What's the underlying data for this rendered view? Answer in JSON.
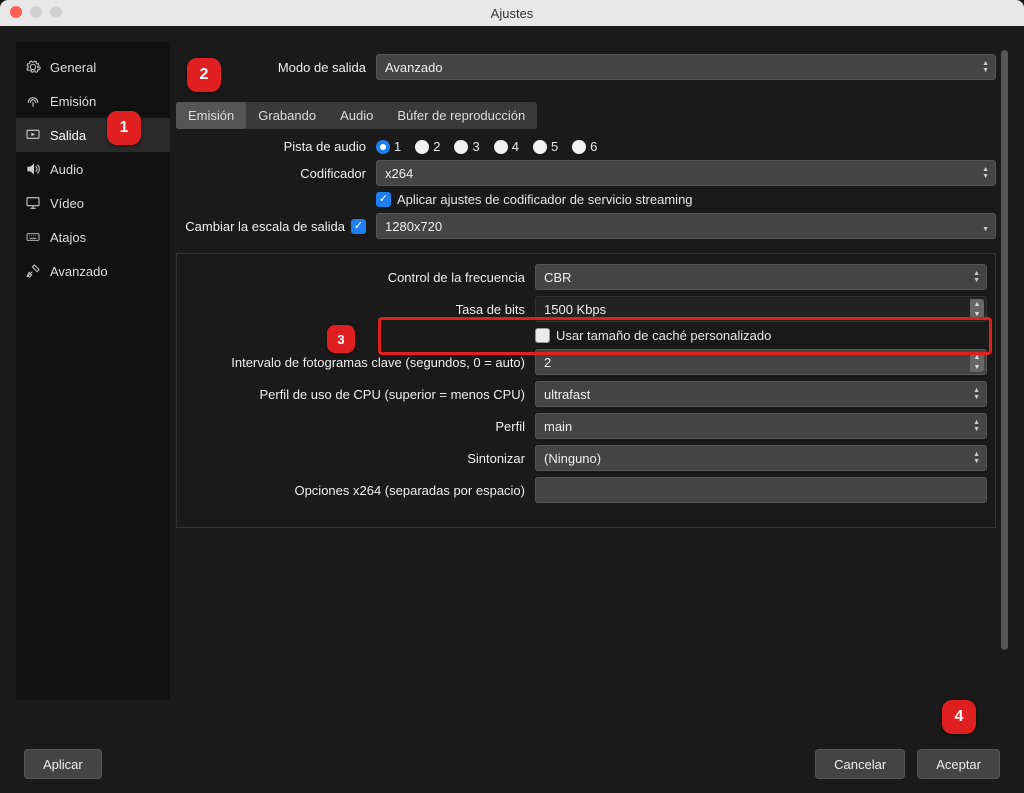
{
  "window": {
    "title": "Ajustes"
  },
  "sidebar": {
    "items": [
      {
        "label": "General"
      },
      {
        "label": "Emisión"
      },
      {
        "label": "Salida"
      },
      {
        "label": "Audio"
      },
      {
        "label": "Vídeo"
      },
      {
        "label": "Atajos"
      },
      {
        "label": "Avanzado"
      }
    ]
  },
  "mode": {
    "label": "Modo de salida",
    "value": "Avanzado"
  },
  "tabs": [
    "Emisión",
    "Grabando",
    "Audio",
    "Búfer de reproducción"
  ],
  "audio_track": {
    "label": "Pista de audio",
    "options": [
      "1",
      "2",
      "3",
      "4",
      "5",
      "6"
    ],
    "selected": "1"
  },
  "encoder": {
    "label": "Codificador",
    "value": "x264"
  },
  "enforce": {
    "label": "Aplicar ajustes de codificador de servicio streaming"
  },
  "rescale": {
    "label": "Cambiar la escala de salida",
    "value": "1280x720"
  },
  "rate_control": {
    "label": "Control de la frecuencia",
    "value": "CBR"
  },
  "bitrate": {
    "label": "Tasa de bits",
    "value": "1500 Kbps"
  },
  "custom_buf": {
    "label": "Usar tamaño de caché personalizado"
  },
  "keyframe": {
    "label": "Intervalo de fotogramas clave (segundos, 0 = auto)",
    "value": "2"
  },
  "cpu_preset": {
    "label": "Perfil de uso de CPU (superior = menos CPU)",
    "value": "ultrafast"
  },
  "profile": {
    "label": "Perfil",
    "value": "main"
  },
  "tune": {
    "label": "Sintonizar",
    "value": "(Ninguno)"
  },
  "x264opts": {
    "label": "Opciones x264 (separadas por espacio)",
    "value": ""
  },
  "footer": {
    "apply": "Aplicar",
    "cancel": "Cancelar",
    "ok": "Aceptar"
  },
  "callouts": {
    "c1": "1",
    "c2": "2",
    "c3": "3",
    "c4": "4"
  }
}
